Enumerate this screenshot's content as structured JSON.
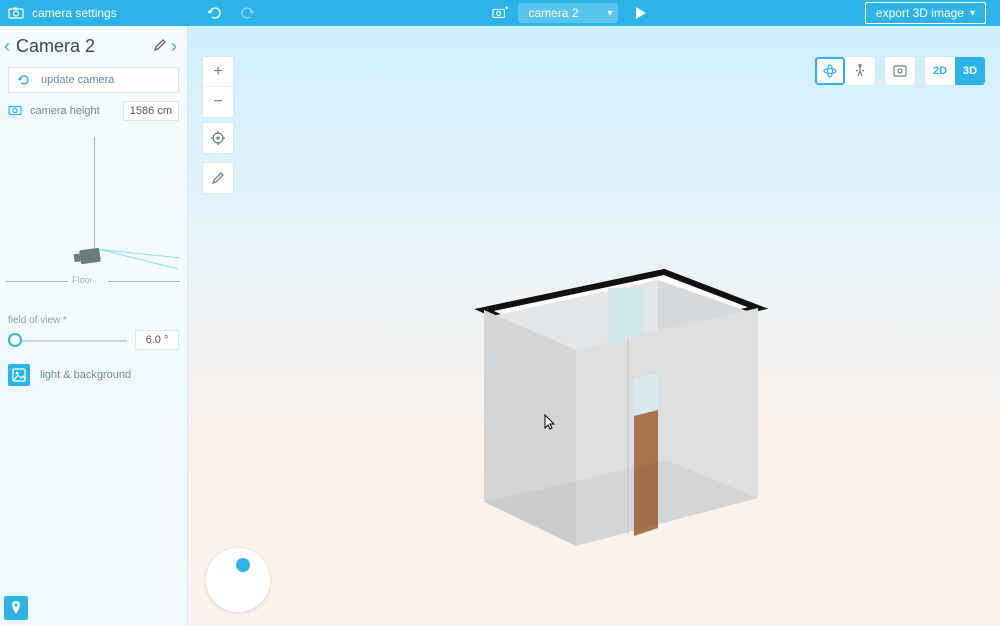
{
  "colors": {
    "accent": "#2cb4e8"
  },
  "topbar": {
    "title": "camera settings",
    "undo_icon": "undo-icon",
    "redo_icon": "redo-icon",
    "camera_dropdown_label": "camera 2",
    "export_label": "export 3D image"
  },
  "sidebar": {
    "prev_icon": "‹",
    "next_icon": "›",
    "camera_name": "Camera 2",
    "update_camera_label": "update camera",
    "camera_height_label": "camera height",
    "camera_height_value": "1586 cm",
    "floor_label": "Floor",
    "fov_label": "field of view *",
    "fov_value": "6.0 °",
    "light_bg_label": "light & background"
  },
  "viewport": {
    "tools": {
      "zoom_in": "+",
      "zoom_out": "−",
      "recenter": "recenter-icon",
      "edit": "pencil-icon"
    },
    "view_modes": {
      "orbit": "orbit-icon",
      "walk": "walk-icon",
      "first_person": "fp-icon",
      "mode_2d": "2D",
      "mode_3d": "3D"
    }
  }
}
